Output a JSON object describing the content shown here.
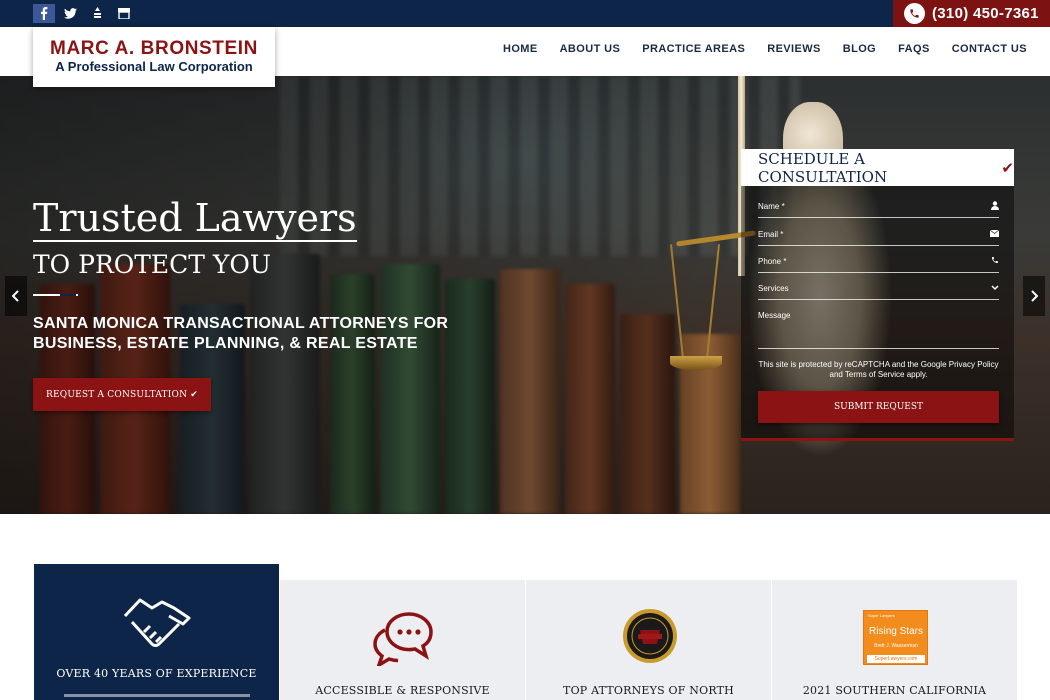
{
  "topbar": {
    "social": [
      {
        "name": "facebook",
        "glyph": "f"
      },
      {
        "name": "twitter",
        "glyph": "t"
      },
      {
        "name": "bbb",
        "glyph": "b"
      },
      {
        "name": "google-business",
        "glyph": "g"
      }
    ],
    "phone": "(310) 450-7361"
  },
  "logo": {
    "name": "MARC A. BRONSTEIN",
    "subtitle": "A Professional Law Corporation"
  },
  "nav": {
    "items": [
      "HOME",
      "ABOUT US",
      "PRACTICE AREAS",
      "REVIEWS",
      "BLOG",
      "FAQS",
      "CONTACT US"
    ],
    "active": "HOME"
  },
  "hero": {
    "title_line1": "Trusted Lawyers",
    "title_line2": "TO PROTECT YOU",
    "subtitle": "SANTA MONICA TRANSACTIONAL ATTORNEYS FOR BUSINESS, ESTATE PLANNING, & REAL ESTATE",
    "cta_label": "REQUEST A CONSULTATION ✔"
  },
  "form": {
    "title": "SCHEDULE A CONSULTATION",
    "fields": {
      "name": "Name *",
      "email": "Email *",
      "phone": "Phone *",
      "services": "Services",
      "message": "Message"
    },
    "recaptcha_note": "This site is protected by reCAPTCHA and the Google Privacy Policy and Terms of Service apply.",
    "submit_label": "SUBMIT REQUEST"
  },
  "features": [
    {
      "title": "OVER 40 YEARS OF EXPERIENCE"
    },
    {
      "title": "ACCESSIBLE & RESPONSIVE"
    },
    {
      "title": "TOP ATTORNEYS OF NORTH"
    },
    {
      "title": "2021 SOUTHERN CALIFORNIA"
    }
  ],
  "badges": {
    "rising_stars_top": "Super Lawyers",
    "rising_stars": "Rising Stars",
    "rising_stars_name": "Brett J. Wasserman",
    "rising_stars_site": "SuperLawyers.com"
  },
  "colors": {
    "navy": "#0d2548",
    "maroon": "#8b1313",
    "light_gray": "#eceef1"
  }
}
